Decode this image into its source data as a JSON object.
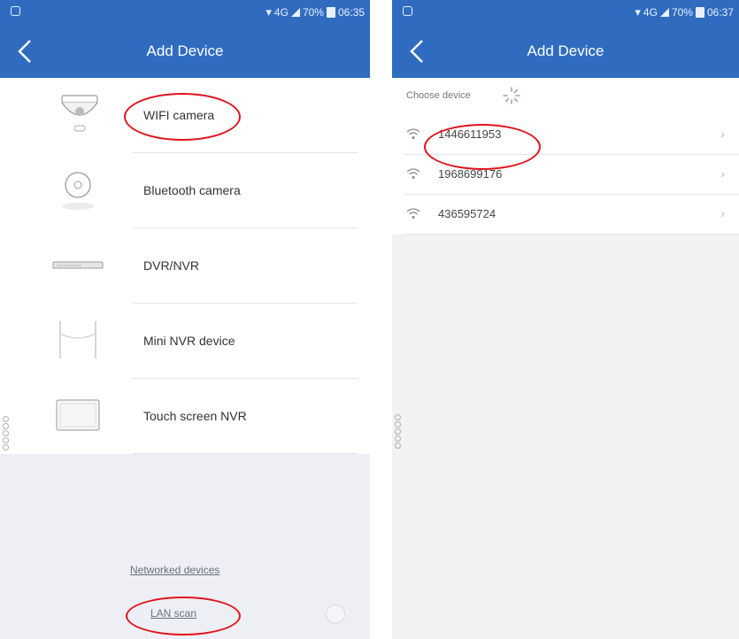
{
  "left": {
    "status": {
      "network": "4G",
      "battery": "70%",
      "time": "06:35"
    },
    "title": "Add Device",
    "devices": [
      {
        "label": "WIFI camera",
        "icon": "dome-camera-icon"
      },
      {
        "label": "Bluetooth camera",
        "icon": "round-camera-icon"
      },
      {
        "label": "DVR/NVR",
        "icon": "dvr-box-icon"
      },
      {
        "label": "Mini NVR device",
        "icon": "mini-nvr-icon"
      },
      {
        "label": "Touch screen NVR",
        "icon": "touch-screen-icon"
      }
    ],
    "links": {
      "networked": "Networked devices",
      "lan_scan": "LAN scan"
    }
  },
  "right": {
    "status": {
      "network": "4G",
      "battery": "70%",
      "time": "06:37"
    },
    "title": "Add Device",
    "choose_label": "Choose device",
    "devices": [
      {
        "id": "1446611953"
      },
      {
        "id": "1968699176"
      },
      {
        "id": "436595724"
      }
    ]
  },
  "colors": {
    "header": "#2f6cc0",
    "highlight": "#e0141c"
  }
}
